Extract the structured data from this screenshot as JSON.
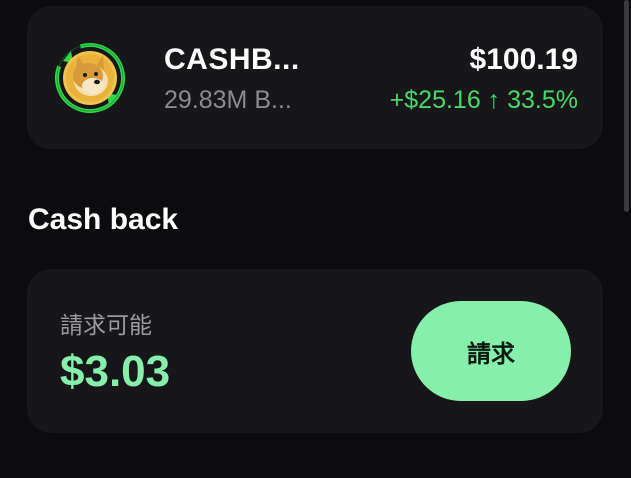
{
  "token": {
    "name": "CASHB...",
    "subtitle": "29.83M B...",
    "price": "$100.19",
    "change": "+$25.16 ↑ 33.5%",
    "icon": "doge-cashback-icon"
  },
  "section": {
    "title": "Cash back"
  },
  "cashback": {
    "label": "請求可能",
    "amount": "$3.03",
    "button_label": "請求"
  },
  "colors": {
    "background": "#0c0c0e",
    "card": "#17171a",
    "positive": "#48d868",
    "accent": "#86efac"
  }
}
